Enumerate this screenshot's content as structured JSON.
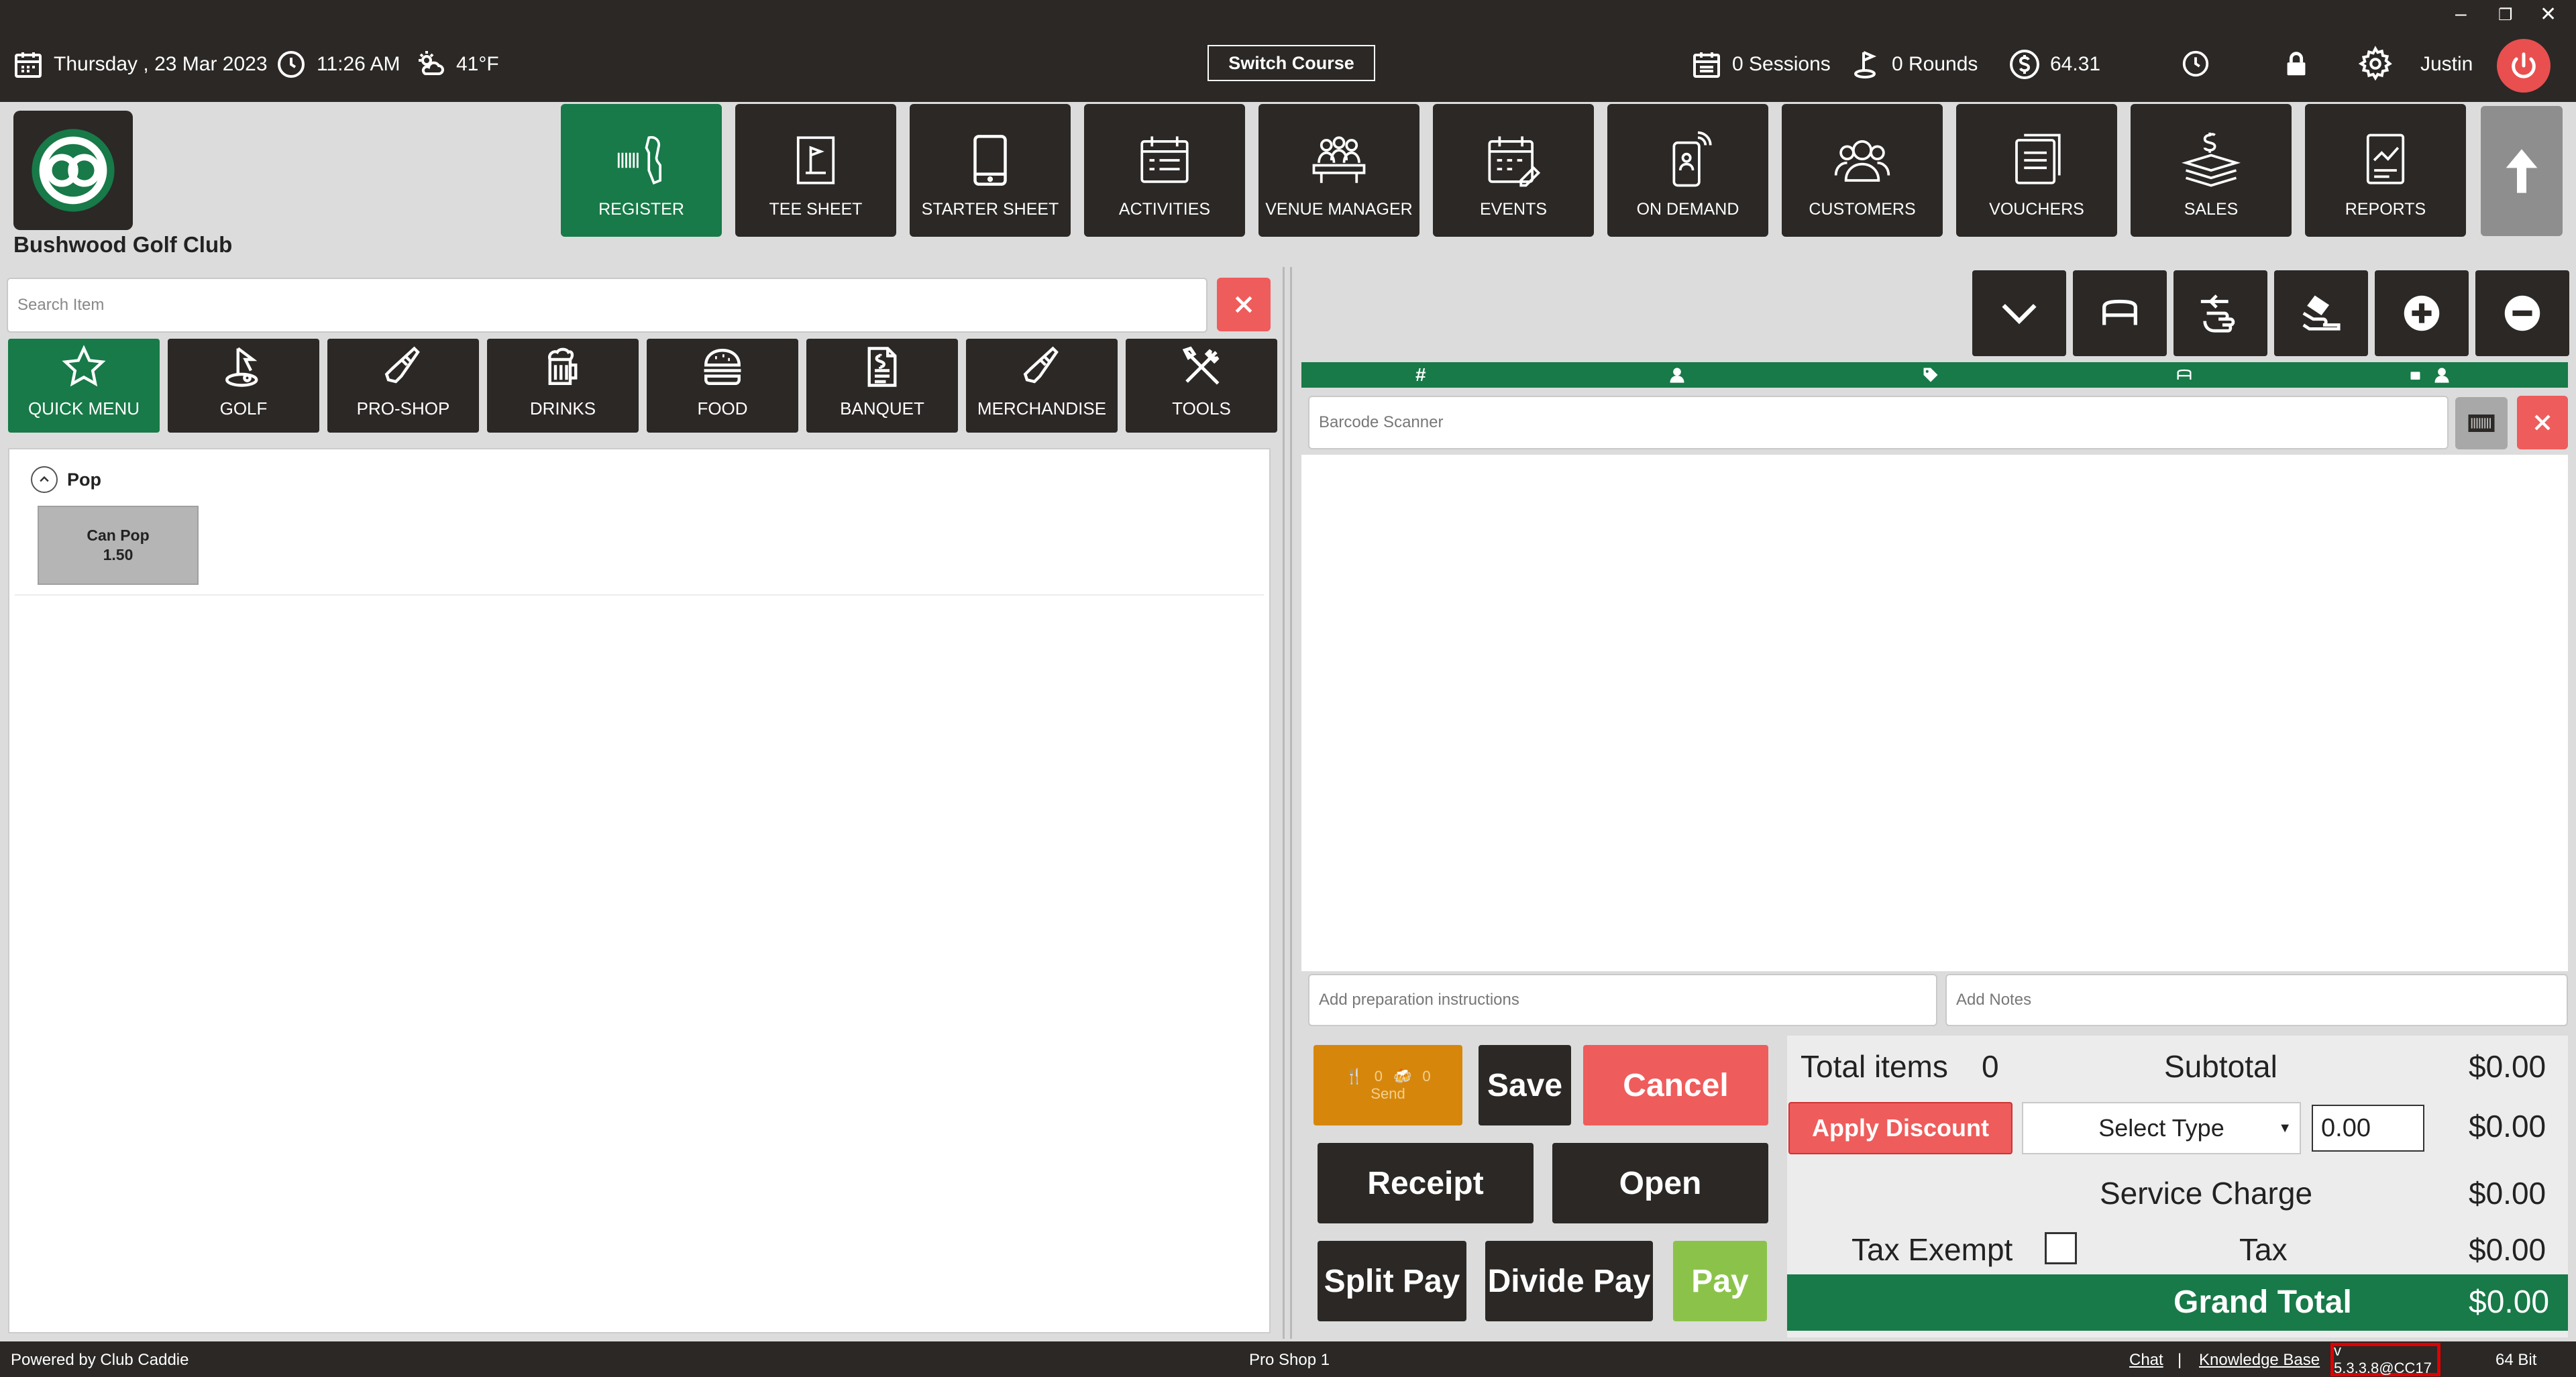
{
  "topbar": {
    "date_day": "Thursday ,",
    "date": "23 Mar 2023",
    "time": "11:26 AM",
    "weather": "41°F",
    "switch_course": "Switch Course",
    "sessions": "0 Sessions",
    "rounds": "0 Rounds",
    "balance": "64.31",
    "user": "Justin"
  },
  "header": {
    "club_name": "Bushwood Golf Club",
    "nav": [
      {
        "label": "REGISTER",
        "icon": "barcode-scanner-icon",
        "active": true
      },
      {
        "label": "TEE SHEET",
        "icon": "tee-sheet-icon"
      },
      {
        "label": "STARTER SHEET",
        "icon": "tablet-icon"
      },
      {
        "label": "ACTIVITIES",
        "icon": "calendar-list-icon"
      },
      {
        "label": "VENUE MANAGER",
        "icon": "meeting-icon"
      },
      {
        "label": "EVENTS",
        "icon": "event-calendar-icon"
      },
      {
        "label": "ON DEMAND",
        "icon": "phone-icon"
      },
      {
        "label": "CUSTOMERS",
        "icon": "users-icon"
      },
      {
        "label": "VOUCHERS",
        "icon": "voucher-icon"
      },
      {
        "label": "SALES",
        "icon": "money-icon"
      },
      {
        "label": "REPORTS",
        "icon": "report-icon"
      }
    ]
  },
  "left": {
    "search_placeholder": "Search Item",
    "categories": [
      {
        "label": "QUICK MENU",
        "icon": "star-icon",
        "active": true
      },
      {
        "label": "GOLF",
        "icon": "golf-icon"
      },
      {
        "label": "PRO-SHOP",
        "icon": "golf-club-icon"
      },
      {
        "label": "DRINKS",
        "icon": "beer-icon"
      },
      {
        "label": "FOOD",
        "icon": "burger-icon"
      },
      {
        "label": "BANQUET",
        "icon": "document-icon"
      },
      {
        "label": "MERCHANDISE",
        "icon": "golf-club-icon"
      },
      {
        "label": "TOOLS",
        "icon": "tools-icon"
      }
    ],
    "group": "Pop",
    "items": [
      {
        "name": "Can Pop",
        "price": "1.50"
      }
    ]
  },
  "right": {
    "barcode_placeholder": "Barcode Scanner",
    "prep_placeholder": "Add preparation instructions",
    "notes_placeholder": "Add Notes",
    "send_count_a": "0",
    "send_count_b": "0",
    "send_label": "Send",
    "save": "Save",
    "cancel": "Cancel",
    "receipt": "Receipt",
    "open": "Open",
    "split_pay": "Split Pay",
    "divide_pay": "Divide Pay",
    "pay": "Pay"
  },
  "totals": {
    "total_items_label": "Total items",
    "total_items": "0",
    "subtotal_label": "Subtotal",
    "subtotal": "$0.00",
    "apply_discount": "Apply Discount",
    "select_type": "Select Type",
    "discount_value": "0.00",
    "discount": "$0.00",
    "service_charge_label": "Service Charge",
    "service_charge": "$0.00",
    "tax_exempt_label": "Tax Exempt",
    "tax_label": "Tax",
    "tax": "$0.00",
    "grand_total_label": "Grand Total",
    "grand_total": "$0.00"
  },
  "footer": {
    "powered": "Powered by Club Caddie",
    "station": "Pro Shop 1",
    "chat": "Chat",
    "separator": "|",
    "kb": "Knowledge Base",
    "version": "v 5.3.3.8@CC17",
    "bits": "64 Bit"
  },
  "colors": {
    "dark": "#2b2826",
    "green": "#177a48",
    "red": "#ef5c5c",
    "orange": "#d6870b",
    "light_green": "#8bc34a"
  }
}
